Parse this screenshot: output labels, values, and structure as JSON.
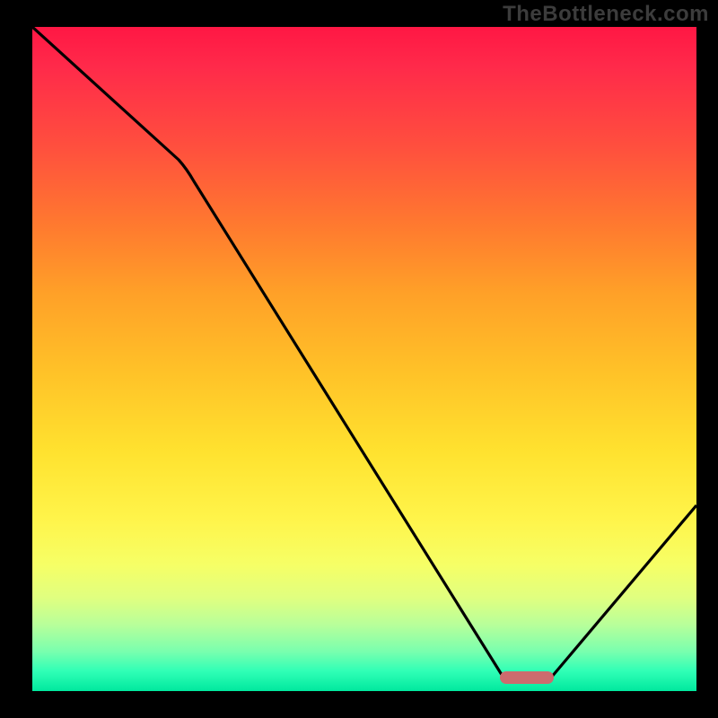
{
  "watermark": "TheBottleneck.com",
  "colors": {
    "background": "#000000",
    "curve_stroke": "#000000",
    "marker_fill": "#cc6b6e",
    "gradient_top": "#ff1744",
    "gradient_mid": "#ffe22f",
    "gradient_bottom": "#00e89e"
  },
  "chart_data": {
    "type": "line",
    "title": "",
    "xlabel": "",
    "ylabel": "",
    "xlim": [
      0,
      100
    ],
    "ylim": [
      0,
      100
    ],
    "grid": false,
    "series": [
      {
        "name": "bottleneck-curve",
        "x": [
          0,
          22,
          71,
          78,
          100
        ],
        "values": [
          100,
          80,
          2,
          2,
          28
        ]
      }
    ],
    "annotations": [
      {
        "name": "optimal-marker",
        "shape": "rounded-bar",
        "x_start": 71,
        "x_end": 78,
        "y": 2,
        "color": "#cc6b6e"
      }
    ]
  }
}
